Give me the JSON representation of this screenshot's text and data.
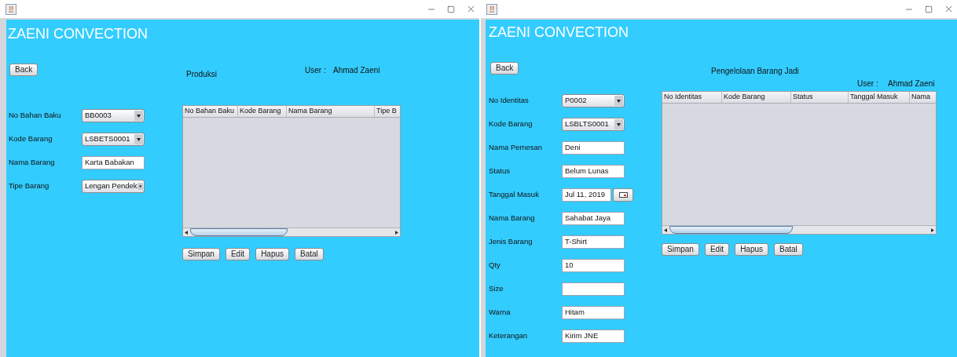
{
  "windows": [
    {
      "app_title": "ZAENI CONVECTION",
      "back_button": "Back",
      "page_title": "Produksi",
      "user_label": "User :",
      "user_name": "Ahmad Zaeni",
      "fields": [
        {
          "label": "No Bahan Baku",
          "kind": "combo",
          "value": "BB0003"
        },
        {
          "label": "Kode Barang",
          "kind": "combo",
          "value": "LSBETS0001"
        },
        {
          "label": "Nama Barang",
          "kind": "text",
          "value": "Karta Babakan"
        },
        {
          "label": "Tipe Barang",
          "kind": "combo",
          "value": "Lengan Pendek"
        }
      ],
      "table": {
        "columns": [
          "No Bahan Baku",
          "Kode Barang",
          "Nama Barang",
          "Tipe B"
        ]
      },
      "buttons": [
        "Simpan",
        "Edit",
        "Hapus",
        "Batal"
      ]
    },
    {
      "app_title": "ZAENI CONVECTION",
      "back_button": "Back",
      "page_title": "Pengelolaan Barang Jadi",
      "user_label": "User :",
      "user_name": "Ahmad Zaeni",
      "fields": [
        {
          "label": "No Identitas",
          "kind": "combo",
          "value": "P0002"
        },
        {
          "label": "Kode Barang",
          "kind": "combo",
          "value": "LSBLTS0001"
        },
        {
          "label": "Nama Pemesan",
          "kind": "text",
          "value": "Deni"
        },
        {
          "label": "Status",
          "kind": "text",
          "value": "Belum Lunas"
        },
        {
          "label": "Tanggal Masuk",
          "kind": "date",
          "value": "Jul 11, 2019"
        },
        {
          "label": "Nama Barang",
          "kind": "text",
          "value": "Sahabat Jaya"
        },
        {
          "label": "Jenis Barang",
          "kind": "text",
          "value": "T-Shirt"
        },
        {
          "label": "Qty",
          "kind": "text",
          "value": "10"
        },
        {
          "label": "Size",
          "kind": "text"
        },
        {
          "label": "Warna",
          "kind": "text",
          "value": "Hitam"
        },
        {
          "label": "Keterangan",
          "kind": "text",
          "value": "Kirim JNE"
        }
      ],
      "table": {
        "columns": [
          "No Identitas",
          "Kode Barang",
          "Status",
          "Tanggal Masuk",
          "Nama"
        ]
      },
      "buttons": [
        "Simpan",
        "Edit",
        "Hapus",
        "Batal"
      ]
    }
  ]
}
